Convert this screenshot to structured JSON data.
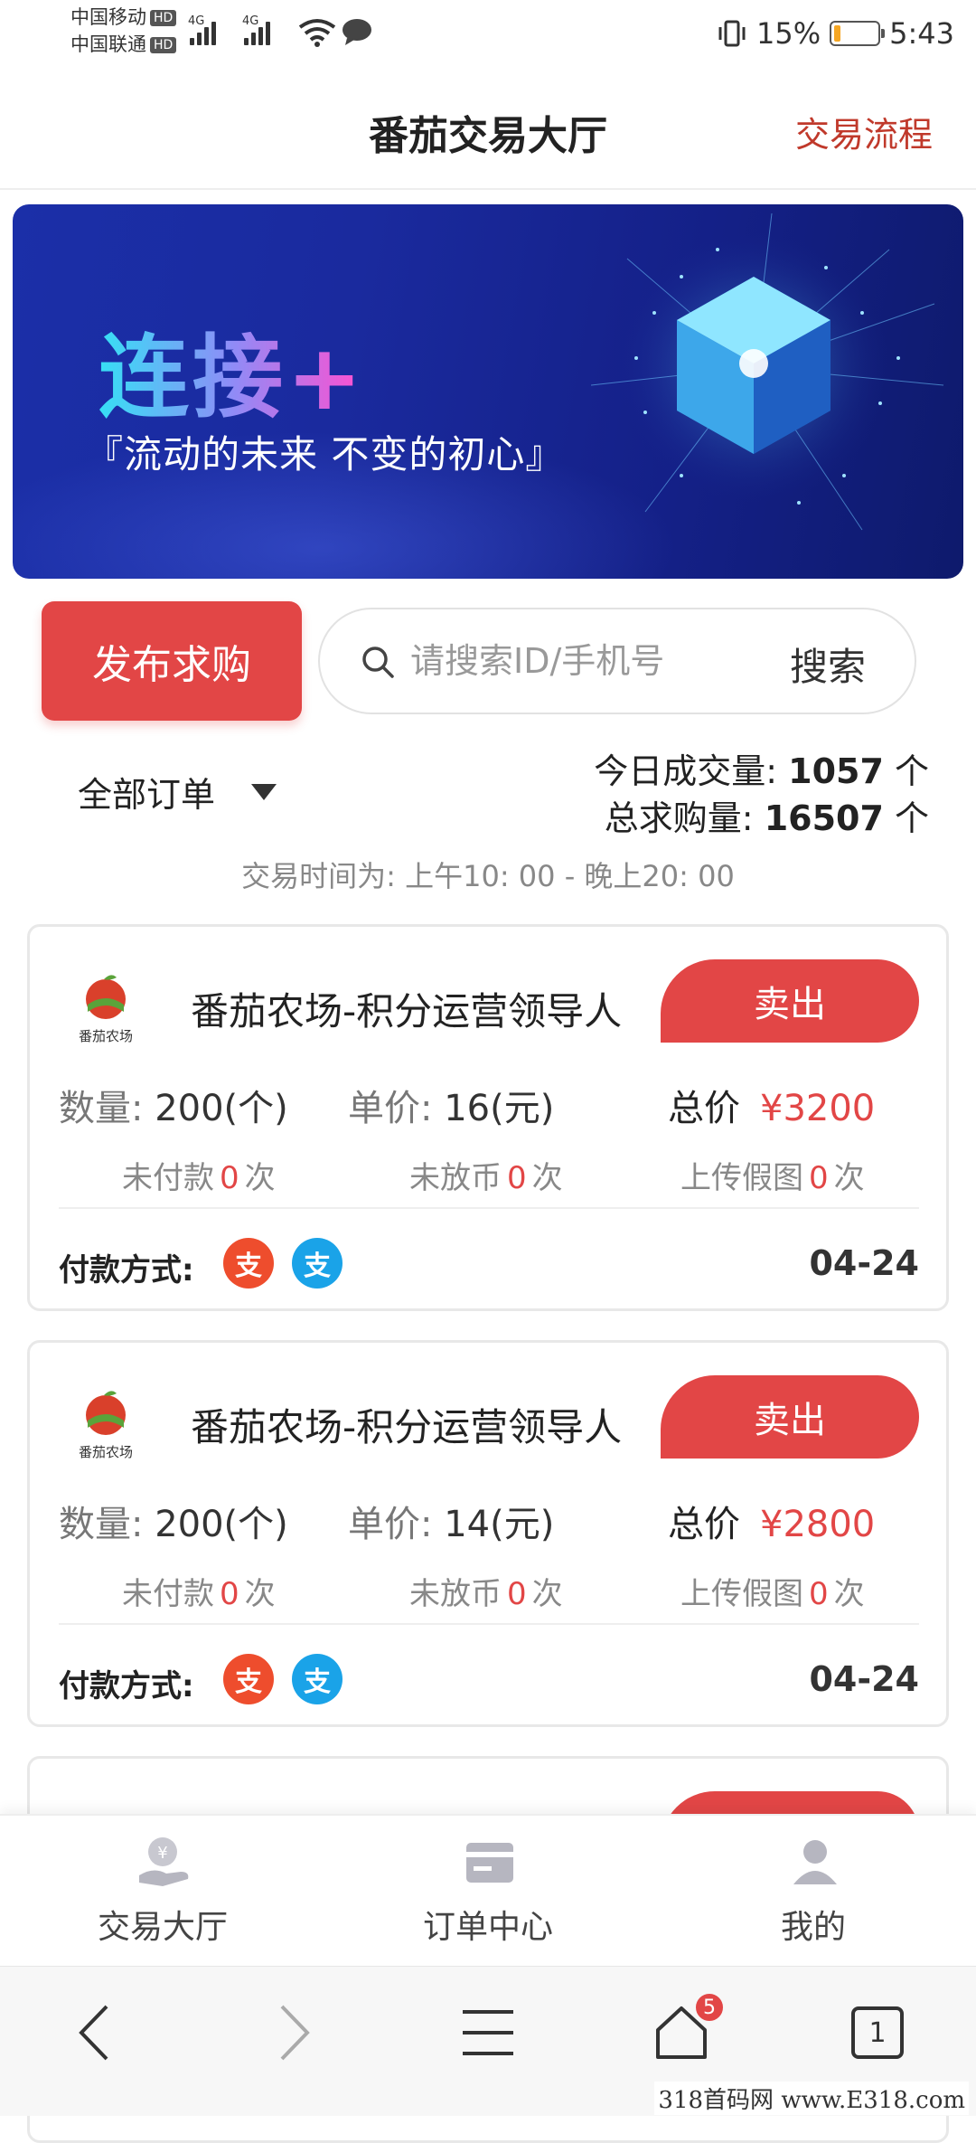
{
  "status_bar": {
    "carrier1": "中国移动",
    "carrier2": "中国联通",
    "hd": "HD",
    "net1": "4G",
    "net2": "4G",
    "battery": "15%",
    "battery_level": 0.15,
    "time": "5:43"
  },
  "header": {
    "title": "番茄交易大厅",
    "process_link": "交易流程"
  },
  "banner": {
    "headline": "连接+",
    "tagline": "『流动的未来 不变的初心』"
  },
  "actions": {
    "publish_label": "发布求购",
    "search_placeholder": "请搜索ID/手机号",
    "search_button": "搜索"
  },
  "filter": {
    "selected": "全部订单"
  },
  "stats": {
    "today_label": "今日成交量:",
    "today_value": "1057",
    "today_unit": "个",
    "total_label": "总求购量:",
    "total_value": "16507",
    "total_unit": "个"
  },
  "trading_hours": "交易时间为: 上午10: 00 - 晚上20: 00",
  "orders": [
    {
      "name": "番茄农场-积分运营领导人",
      "sell_label": "卖出",
      "qty_label": "数量:",
      "qty": "200(个)",
      "price_label": "单价:",
      "price": "16(元)",
      "total_label": "总价",
      "total": "¥3200",
      "unpaid_label": "未付款",
      "unpaid": "0",
      "unreleased_label": "未放币",
      "unreleased": "0",
      "fake_label": "上传假图",
      "fake": "0",
      "times_unit": "次",
      "pay_label": "付款方式:",
      "date": "04-24"
    },
    {
      "name": "番茄农场-积分运营领导人",
      "sell_label": "卖出",
      "qty_label": "数量:",
      "qty": "200(个)",
      "price_label": "单价:",
      "price": "14(元)",
      "total_label": "总价",
      "total": "¥2800",
      "unpaid_label": "未付款",
      "unpaid": "0",
      "unreleased_label": "未放币",
      "unreleased": "0",
      "fake_label": "上传假图",
      "fake": "0",
      "times_unit": "次",
      "pay_label": "付款方式:",
      "date": "04-24"
    }
  ],
  "logo_text": "番茄农场",
  "payment_icons": [
    "wechat-pay-icon",
    "alipay-icon"
  ],
  "pay_glyph": "支",
  "tabbar": {
    "hall": "交易大厅",
    "orders": "订单中心",
    "mine": "我的"
  },
  "browser": {
    "tab_count": "1",
    "home_badge": "5"
  },
  "watermark": "318首码网 www.E318.com",
  "colors": {
    "accent": "#e24646",
    "link": "#c0392b",
    "wechat_pay": "#ee4d2d",
    "alipay": "#1aa3e8"
  }
}
